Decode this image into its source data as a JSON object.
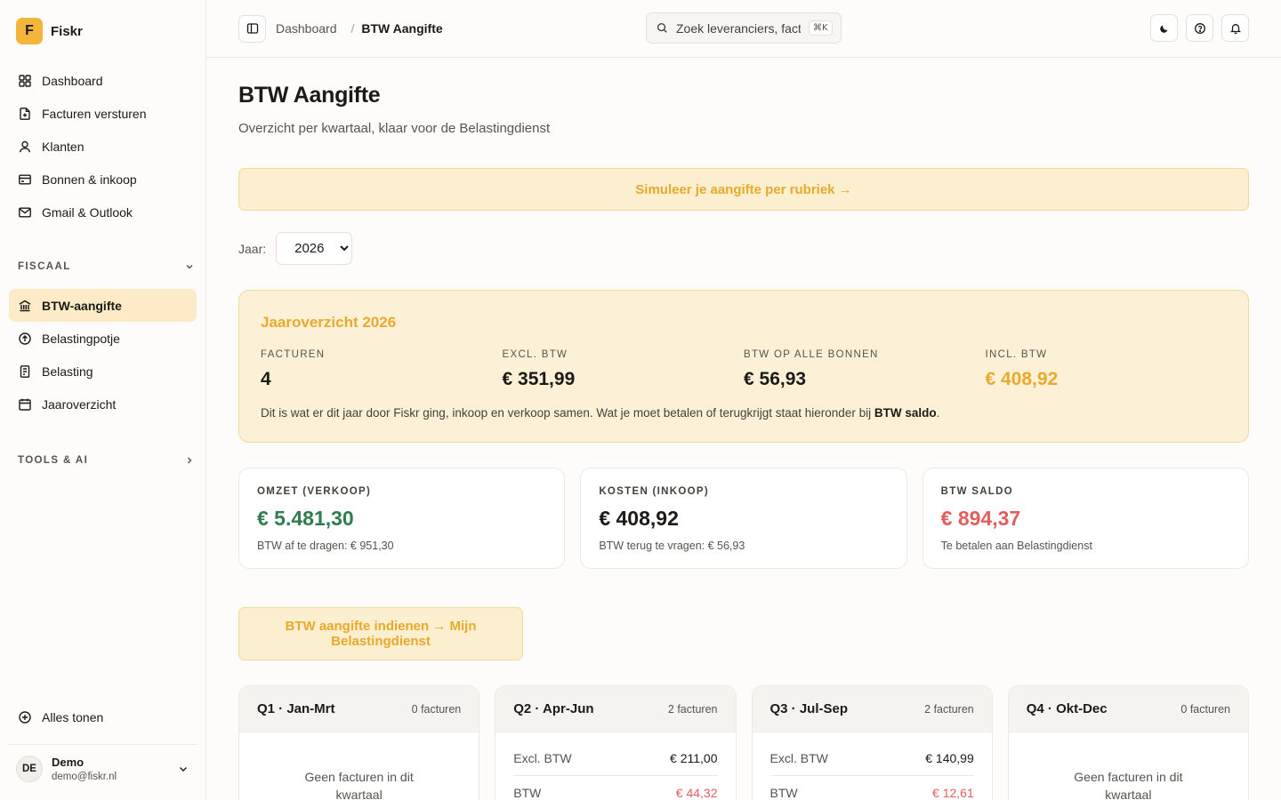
{
  "brand": {
    "logo_letter": "F",
    "name": "Fiskr"
  },
  "sidebar": {
    "items": [
      {
        "label": "Dashboard",
        "icon": "grid-icon"
      },
      {
        "label": "Facturen versturen",
        "icon": "file-plus-icon"
      },
      {
        "label": "Klanten",
        "icon": "user-icon"
      },
      {
        "label": "Bonnen & inkoop",
        "icon": "credit-card-icon"
      },
      {
        "label": "Gmail & Outlook",
        "icon": "mail-icon"
      }
    ],
    "section_fiscaal": "FISCAAL",
    "fiscaal_items": [
      {
        "label": "BTW-aangifte",
        "icon": "landmark-icon",
        "active": true
      },
      {
        "label": "Belastingpotje",
        "icon": "circle-arrow-icon"
      },
      {
        "label": "Belasting",
        "icon": "receipt-icon"
      },
      {
        "label": "Jaaroverzicht",
        "icon": "calendar-icon"
      }
    ],
    "section_tools": "TOOLS & AI",
    "show_all": "Alles tonen",
    "user": {
      "initials": "DE",
      "name": "Demo",
      "email": "demo@fiskr.nl"
    }
  },
  "topbar": {
    "breadcrumb_parent": "Dashboard",
    "breadcrumb_sep": "/",
    "breadcrumb_current": "BTW Aangifte",
    "search_placeholder": "Zoek leveranciers, facturen...",
    "search_shortcut": "⌘K"
  },
  "page": {
    "title": "BTW Aangifte",
    "subtitle": "Overzicht per kwartaal, klaar voor de Belastingdienst",
    "simulate_label": "Simuleer je aangifte per rubriek →",
    "year_label": "Jaar:",
    "year_value": "2026",
    "year_options": [
      "2026"
    ]
  },
  "year_overview": {
    "title": "Jaaroverzicht 2026",
    "stats": [
      {
        "label": "FACTUREN",
        "value": "4"
      },
      {
        "label": "EXCL. BTW",
        "value": "€ 351,99"
      },
      {
        "label": "BTW OP ALLE BONNEN",
        "value": "€ 56,93"
      },
      {
        "label": "INCL. BTW",
        "value": "€ 408,92"
      }
    ],
    "note_before": "Dit is wat er dit jaar door Fiskr ging, inkoop en verkoop samen. Wat je moet betalen of terugkrijgt staat hieronder bij ",
    "note_bold": "BTW saldo",
    "note_after": "."
  },
  "kpis": [
    {
      "label": "OMZET (VERKOOP)",
      "value": "€ 5.481,30",
      "note": "BTW af te dragen: € 951,30"
    },
    {
      "label": "KOSTEN (INKOOP)",
      "value": "€ 408,92",
      "note": "BTW terug te vragen: € 56,93"
    },
    {
      "label": "BTW SALDO",
      "value": "€ 894,37",
      "note": "Te betalen aan Belastingdienst"
    }
  ],
  "submit_label": "BTW aangifte indienen → Mijn Belastingdienst",
  "quarters": [
    {
      "title": "Q1 · Jan-Mrt",
      "count": "0 facturen",
      "empty": "Geen facturen in dit kwartaal"
    },
    {
      "title": "Q2 · Apr-Jun",
      "count": "2 facturen",
      "rows": [
        {
          "label": "Excl. BTW",
          "value": "€ 211,00"
        },
        {
          "label": "BTW",
          "value": "€ 44,32"
        }
      ]
    },
    {
      "title": "Q3 · Jul-Sep",
      "count": "2 facturen",
      "rows": [
        {
          "label": "Excl. BTW",
          "value": "€ 140,99"
        },
        {
          "label": "BTW",
          "value": "€ 12,61"
        }
      ]
    },
    {
      "title": "Q4 · Okt-Dec",
      "count": "0 facturen",
      "empty": "Geen facturen in dit kwartaal"
    }
  ],
  "colors": {
    "accent": "#e8a92c",
    "brand": "#f4b63a",
    "positive": "#2f7d4f",
    "negative": "#e35d5d"
  }
}
